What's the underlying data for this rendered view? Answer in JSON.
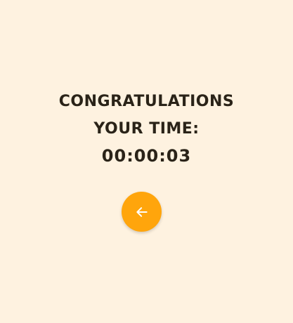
{
  "result": {
    "heading": "CONGRATULATIONS",
    "time_label": "YOUR TIME:",
    "time_value": "00:00:03"
  },
  "back_button": {
    "icon": "arrow-left-icon",
    "color": "#FFA50C"
  },
  "colors": {
    "background": "#FEF2E0",
    "text": "#2A2318",
    "accent": "#FFA50C"
  }
}
